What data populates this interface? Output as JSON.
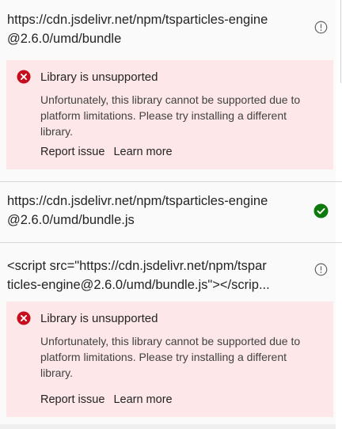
{
  "entries": [
    {
      "url_lines": [
        "https://cdn.jsdelivr.net/npm/tsparticles-engine",
        "@2.6.0/umd/bundle"
      ],
      "status_icon": "info-circle-icon",
      "error": {
        "title": "Library is unsupported",
        "message_lines": [
          "Unfortunately, this library cannot be supported due to",
          "platform limitations. Please try installing a different",
          "library."
        ],
        "report_label": "Report issue",
        "learn_label": "Learn more"
      }
    },
    {
      "url_lines": [
        "https://cdn.jsdelivr.net/npm/tsparticles-engine",
        "@2.6.0/umd/bundle.js"
      ],
      "status_icon": "checkmark-circle-icon"
    },
    {
      "url_lines": [
        "<script src=\"https://cdn.jsdelivr.net/npm/tspar",
        "ticles-engine@2.6.0/umd/bundle.js\"></scrip..."
      ],
      "status_icon": "info-circle-icon",
      "error": {
        "title": "Library is unsupported",
        "message_lines": [
          "Unfortunately, this library cannot be supported due to",
          "platform limitations. Please try installing a different",
          "library."
        ],
        "report_label": "Report issue",
        "learn_label": "Learn more"
      }
    }
  ],
  "colors": {
    "error_background": "#fde7e9",
    "error_icon": "#c50f1f",
    "success_icon": "#0e7a0d",
    "info_icon": "#616161"
  }
}
